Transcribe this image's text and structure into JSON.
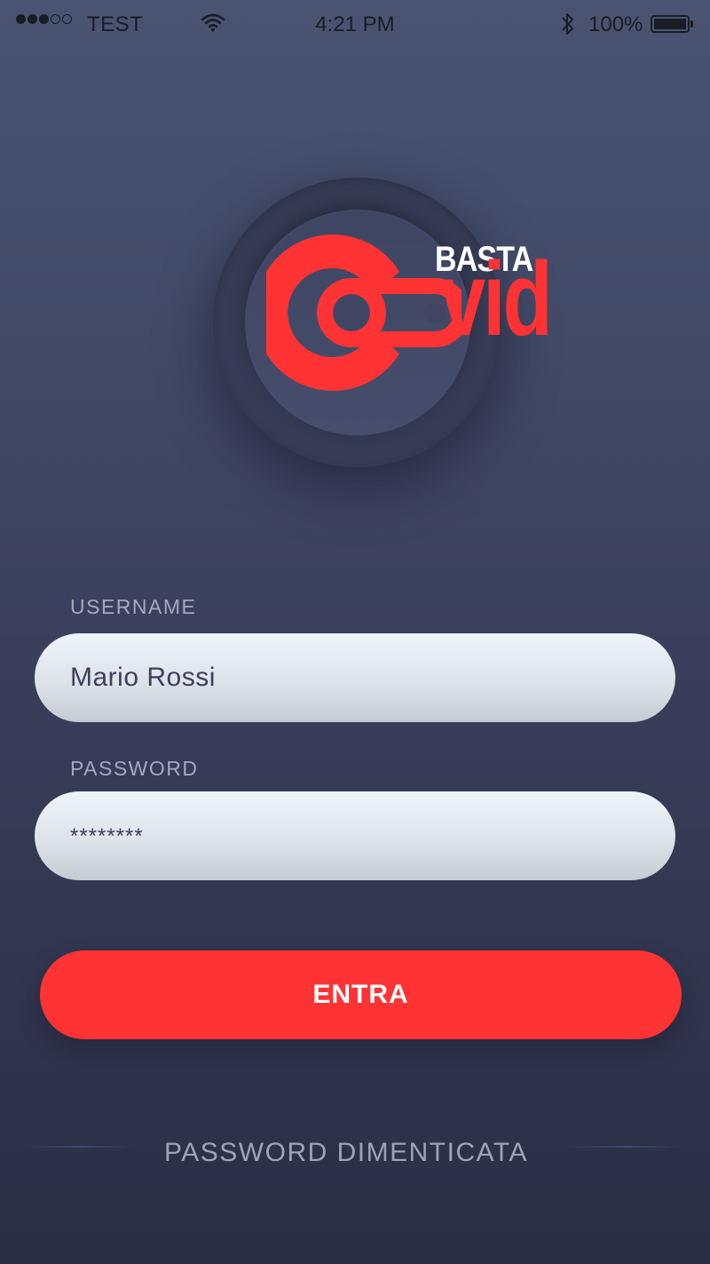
{
  "status_bar": {
    "carrier": "TEST",
    "time": "4:21 PM",
    "battery": "100%",
    "signal_icons": [
      "signal-dot",
      "signal-dot",
      "signal-dot",
      "signal-dot-empty",
      "signal-dot-empty"
    ]
  },
  "logo": {
    "brand_top": "BASTA",
    "brand_bottom": "vid",
    "brand_color": "#ff3333"
  },
  "form": {
    "username_label": "USERNAME",
    "username_value": "Mario Rossi",
    "password_label": "PASSWORD",
    "password_value": "********",
    "submit_label": "ENTRA",
    "forgot_label": "PASSWORD DIMENTICATA"
  },
  "colors": {
    "accent": "#ff3333",
    "background_top": "#4a5472",
    "background_bottom": "#2b2e45",
    "field_text": "#3b405e"
  }
}
